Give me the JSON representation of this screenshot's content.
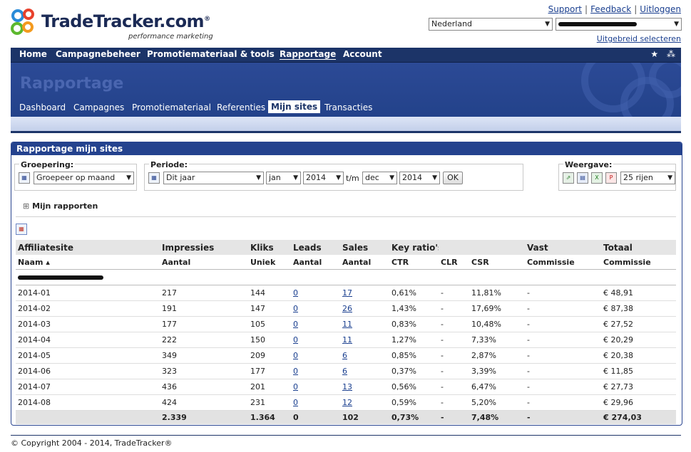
{
  "logo": {
    "name": "TradeTracker.com",
    "registered": "®",
    "tagline": "performance marketing"
  },
  "toplinks": [
    "Support",
    "Feedback",
    "Uitloggen"
  ],
  "country_select": "Nederland",
  "account_select": "",
  "advanced_link": "Uitgebreid selecteren",
  "nav": [
    "Home",
    "Campagnebeheer",
    "Promotiemateriaal & tools",
    "Rapportage",
    "Account"
  ],
  "nav_active": "Rapportage",
  "nav_icons": {
    "star": "★",
    "sitemap": "⁂"
  },
  "banner_title": "Rapportage",
  "subnav": [
    "Dashboard",
    "Campagnes",
    "Promotiemateriaal",
    "Referenties",
    "Mijn sites",
    "Transacties"
  ],
  "subnav_active": "Mijn sites",
  "panel_title": "Rapportage mijn sites",
  "filters": {
    "grouping_label": "Groepering:",
    "grouping_value": "Groepeer op maand",
    "period_label": "Periode:",
    "period_value": "Dit jaar",
    "from_month": "jan",
    "from_year": "2014",
    "tm": "t/m",
    "to_month": "dec",
    "to_year": "2014",
    "ok": "OK",
    "view_label": "Weergave:",
    "rows_value": "25 rijen"
  },
  "my_reports": {
    "toggle": "⊞",
    "label": "Mijn rapporten"
  },
  "table": {
    "head1": [
      "Affiliatesite",
      "Impressies",
      "Kliks",
      "Leads",
      "Sales",
      "Key ratio's",
      "",
      "",
      "Vast",
      "Totaal"
    ],
    "head2": [
      "Naam ▴",
      "Aantal",
      "Uniek",
      "Aantal",
      "Aantal",
      "CTR",
      "CLR",
      "CSR",
      "Commissie",
      "Commissie"
    ],
    "rows": [
      [
        "2014-01",
        "217",
        "144",
        "0",
        "17",
        "0,61%",
        "-",
        "11,81%",
        "-",
        "€ 48,91"
      ],
      [
        "2014-02",
        "191",
        "147",
        "0",
        "26",
        "1,43%",
        "-",
        "17,69%",
        "-",
        "€ 87,38"
      ],
      [
        "2014-03",
        "177",
        "105",
        "0",
        "11",
        "0,83%",
        "-",
        "10,48%",
        "-",
        "€ 27,52"
      ],
      [
        "2014-04",
        "222",
        "150",
        "0",
        "11",
        "1,27%",
        "-",
        "7,33%",
        "-",
        "€ 20,29"
      ],
      [
        "2014-05",
        "349",
        "209",
        "0",
        "6",
        "0,85%",
        "-",
        "2,87%",
        "-",
        "€ 20,38"
      ],
      [
        "2014-06",
        "323",
        "177",
        "0",
        "6",
        "0,37%",
        "-",
        "3,39%",
        "-",
        "€ 11,85"
      ],
      [
        "2014-07",
        "436",
        "201",
        "0",
        "13",
        "0,56%",
        "-",
        "6,47%",
        "-",
        "€ 27,73"
      ],
      [
        "2014-08",
        "424",
        "231",
        "0",
        "12",
        "0,59%",
        "-",
        "5,20%",
        "-",
        "€ 29,96"
      ]
    ],
    "totals": [
      "",
      "2.339",
      "1.364",
      "0",
      "102",
      "0,73%",
      "-",
      "7,48%",
      "-",
      "€ 274,03"
    ]
  },
  "footer": "© Copyright 2004 - 2014, TradeTracker®",
  "colors": {
    "nav": "#1c3468",
    "banner": "#2c4a96",
    "link": "#1a3f8f"
  }
}
